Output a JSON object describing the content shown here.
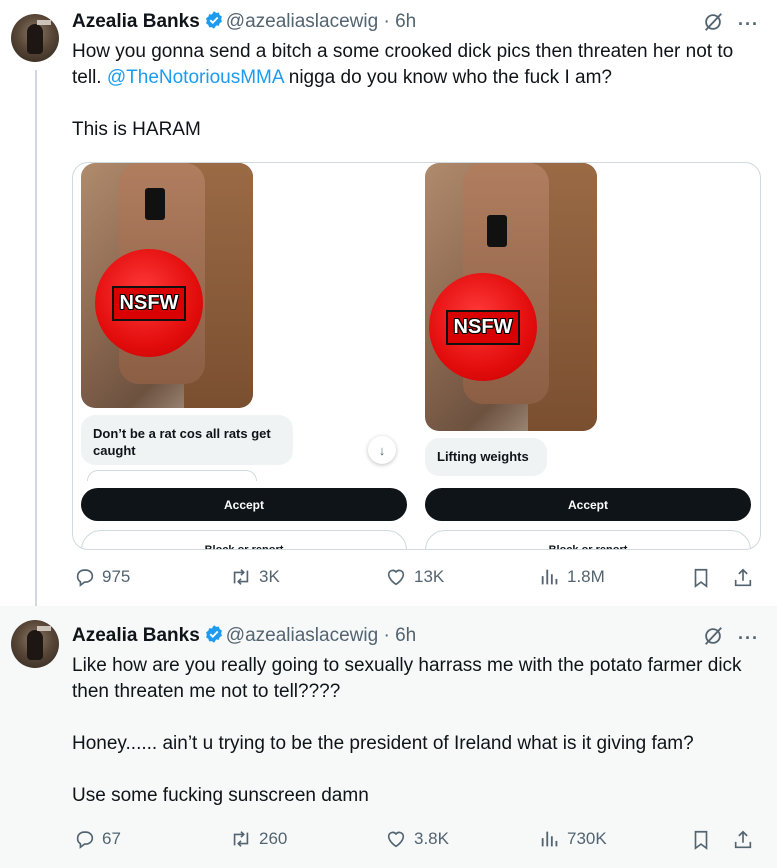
{
  "tweets": [
    {
      "author_name": "Azealia Banks",
      "handle": "@azealiaslacewig",
      "separator": "·",
      "time": "6h",
      "text_part1": "How you gonna send a bitch a some crooked dick pics then threaten her not to tell. ",
      "mention": "@TheNotoriousMMA",
      "text_part2": " nigga do you know who the fuck I am?",
      "text_line2": "This is HARAM",
      "media": {
        "left": {
          "badge": "NSFW",
          "message": "Don’t be a rat cos all rats get caught",
          "accept_label": "Accept",
          "block_label": "Block or report"
        },
        "right": {
          "badge": "NSFW",
          "message": "Lifting weights",
          "accept_label": "Accept",
          "block_label": "Block or report"
        }
      },
      "stats": {
        "replies": "975",
        "reposts": "3K",
        "likes": "13K",
        "views": "1.8M"
      }
    },
    {
      "author_name": "Azealia Banks",
      "handle": "@azealiaslacewig",
      "separator": "·",
      "time": "6h",
      "paragraphs": [
        "Like how are you really going to sexually harrass me with the potato farmer dick then threaten me not to tell????",
        "Honey...... ain’t u trying to be the president of Ireland what is it giving fam?",
        "Use some fucking sunscreen damn"
      ],
      "stats": {
        "replies": "67",
        "reposts": "260",
        "likes": "3.8K",
        "views": "730K"
      }
    }
  ],
  "colors": {
    "accent": "#1d9bf0",
    "text": "#0f1419",
    "muted": "#536471",
    "nsfw_red": "#e30d0d"
  },
  "icons": [
    "verified-badge-icon",
    "grok-icon",
    "more-icon",
    "reply-icon",
    "repost-icon",
    "like-icon",
    "views-icon",
    "bookmark-icon",
    "share-icon",
    "scroll-down-arrow-icon"
  ]
}
